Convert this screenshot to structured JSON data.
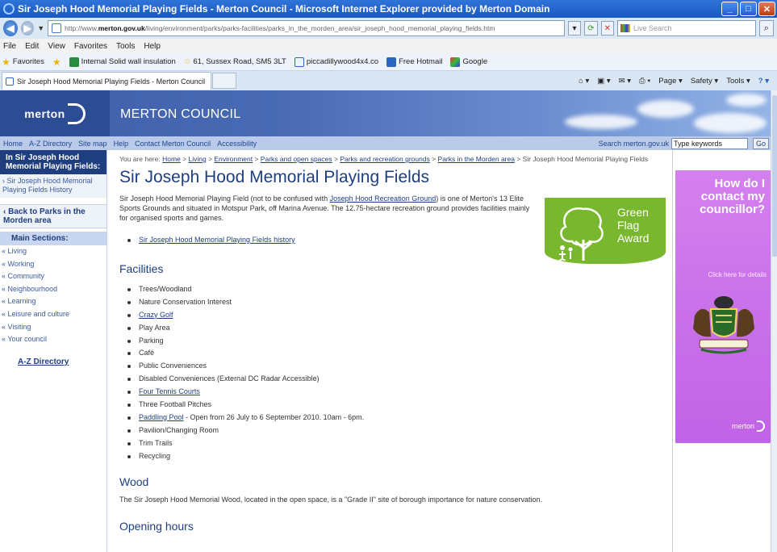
{
  "window": {
    "title": "Sir Joseph Hood Memorial Playing Fields - Merton Council - Microsoft Internet Explorer provided by Merton Domain"
  },
  "browser": {
    "url_prefix": "http://www.",
    "url_domain": "merton.gov.uk",
    "url_path": "/living/environment/parks/parks-facilities/parks_in_the_morden_area/sir_joseph_hood_memorial_playing_fields.htm",
    "live_search_placeholder": "Live Search",
    "menu": [
      "File",
      "Edit",
      "View",
      "Favorites",
      "Tools",
      "Help"
    ],
    "favorites_label": "Favorites",
    "favorites": [
      "Internal Solid wall insulation",
      "61, Sussex Road, SM5 3LT",
      "piccadillywood4x4.co",
      "Free Hotmail",
      "Google"
    ],
    "tab_title": "Sir Joseph Hood Memorial Playing Fields - Merton Council",
    "tab_tools": [
      "Page ▾",
      "Safety ▾",
      "Tools ▾"
    ]
  },
  "site": {
    "logo": "merton",
    "council_name": "MERTON COUNCIL",
    "topnav": [
      "Home",
      "A-Z Directory",
      "Site map",
      "Help",
      "Contact Merton Council",
      "Accessibility"
    ],
    "search_label": "Search merton.gov.uk",
    "search_value": "Type keywords",
    "search_go": "Go"
  },
  "sidebar": {
    "heading": "In Sir Joseph Hood Memorial Playing Fields:",
    "history_link": "Sir Joseph Hood Memorial Playing Fields History",
    "back_link": "Back to Parks in the Morden area",
    "main_sections_heading": "Main Sections:",
    "sections": [
      "Living",
      "Working",
      "Community",
      "Neighbourhood",
      "Learning",
      "Leisure and culture",
      "Visiting",
      "Your council"
    ],
    "az_link": "A-Z Directory"
  },
  "main": {
    "breadcrumb_prefix": "You are here:",
    "breadcrumb": [
      "Home",
      "Living",
      "Environment",
      "Parks and open spaces",
      "Parks and recreation grounds",
      "Parks in the Morden area"
    ],
    "breadcrumb_current": "Sir Joseph Hood Memorial Playing Fields",
    "title": "Sir Joseph Hood Memorial Playing Fields",
    "intro_part1": "Sir Joseph Hood Memorial Playing Field (not to be confused with ",
    "intro_link": "Joseph Hood Recreation Ground",
    "intro_part2": ") is one of Merton's 13 Elite Sports Grounds and situated in Motspur Park, off Marina Avenue. The 12.75-hectare recreation ground provides facilities mainly for organised sports and games.",
    "history_link": "Sir Joseph Hood Memorial Playing Fields history",
    "green_flag": [
      "Green",
      "Flag",
      "Award"
    ],
    "facilities_heading": "Facilities",
    "facilities": [
      {
        "text": "Trees/Woodland",
        "link": false
      },
      {
        "text": "Nature Conservation Interest",
        "link": false
      },
      {
        "text": "Crazy Golf",
        "link": true
      },
      {
        "text": "Play Area",
        "link": false
      },
      {
        "text": "Parking",
        "link": false
      },
      {
        "text": "Café",
        "link": false
      },
      {
        "text": "Public Conveniences",
        "link": false
      },
      {
        "text": "Disabled Conveniences (External DC Radar Accessible)",
        "link": false
      },
      {
        "text": "Four Tennis Courts",
        "link": true
      },
      {
        "text": "Three Football Pitches",
        "link": false
      },
      {
        "text": "Paddling Pool",
        "link": true,
        "suffix": " - Open from 26 July to 6 September 2010. 10am - 6pm."
      },
      {
        "text": "Pavilion/Changing Room",
        "link": false
      },
      {
        "text": "Trim Trails",
        "link": false
      },
      {
        "text": "Recycling",
        "link": false
      }
    ],
    "wood_heading": "Wood",
    "wood_text": "The Sir Joseph Hood Memorial Wood, located in the open space, is a \"Grade II\" site of borough importance for nature conservation.",
    "opening_heading": "Opening hours"
  },
  "ad": {
    "heading": "How do I contact my councillor?",
    "click_text": "Click here for details",
    "logo": "merton"
  },
  "colors": {
    "brand_dark": "#1f3e80",
    "banner": "#4869b3",
    "green_flag": "#79b82e",
    "ad_purple": "#c76ae8"
  }
}
